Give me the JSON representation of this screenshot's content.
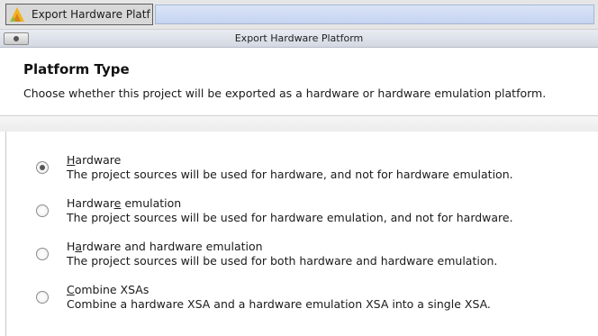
{
  "taskbar": {
    "tab_label": "Export Hardware Platfor",
    "icon": "vivado-logo-icon"
  },
  "window": {
    "title": "Export Hardware Platform",
    "menu_icon": "window-menu-icon"
  },
  "header": {
    "title": "Platform Type",
    "description": "Choose whether this project will be exported as a hardware or hardware emulation platform."
  },
  "options": [
    {
      "label_pre": "",
      "label_mnemonic": "H",
      "label_post": "ardware",
      "description": "The project sources will be used for hardware, and not for hardware emulation.",
      "selected": true
    },
    {
      "label_pre": "Hardwar",
      "label_mnemonic": "e",
      "label_post": " emulation",
      "description": "The project sources will be used for hardware emulation, and not for hardware.",
      "selected": false
    },
    {
      "label_pre": "H",
      "label_mnemonic": "a",
      "label_post": "rdware and hardware emulation",
      "description": "The project sources will be used for both hardware and hardware emulation.",
      "selected": false
    },
    {
      "label_pre": "",
      "label_mnemonic": "C",
      "label_post": "ombine XSAs",
      "description": "Combine a hardware XSA and a hardware emulation XSA into a single XSA.",
      "selected": false
    }
  ]
}
